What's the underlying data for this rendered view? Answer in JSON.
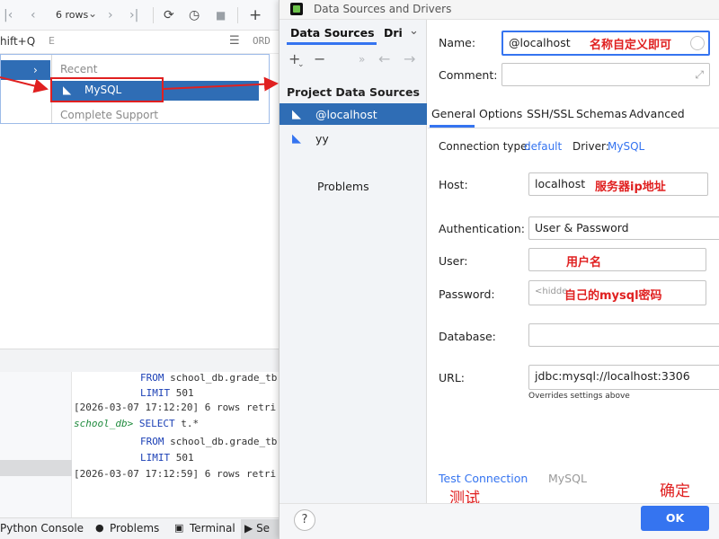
{
  "ide": {
    "toolbar": {
      "first_icon": "|‹",
      "prev_icon": "‹",
      "rows": "6 rows",
      "rows_chevron": "⌄",
      "next_icon": "›",
      "last_icon": "›|",
      "refresh_icon": "⟳",
      "history_icon": "◷",
      "stop_icon": "■",
      "add_icon": "+"
    },
    "row2": {
      "shortcut": "hift+Q",
      "e_label": "E",
      "ord_icon": "☰",
      "ord_label": "ORD"
    },
    "popup": {
      "arrow": "›",
      "recent": "Recent",
      "mysql": "MySQL",
      "complete_support": "Complete Support"
    },
    "console": {
      "lines": [
        {
          "prefix": "",
          "kw": "FROM",
          "rest": " school_db.grade_tb"
        },
        {
          "prefix": "",
          "kw": "LIMIT",
          "rest": " 501"
        },
        {
          "prefix": "[2026-03-07 17:12:20] 6 rows retri",
          "kw": "",
          "rest": ""
        },
        {
          "prompt": "school_db>",
          "kw": " SELECT",
          "rest": " t.*"
        },
        {
          "prefix": "",
          "kw": "FROM",
          "rest": " school_db.grade_tb"
        },
        {
          "prefix": "",
          "kw": "LIMIT",
          "rest": " 501"
        },
        {
          "prefix": "[2026-03-07 17:12:59] 6 rows retri",
          "kw": "",
          "rest": ""
        }
      ]
    },
    "bottom_tabs": {
      "python_console": "Python Console",
      "problems": "Problems",
      "terminal": "Terminal",
      "services": "Se"
    }
  },
  "dialog": {
    "title": "Data Sources and Drivers",
    "tabs": {
      "data_sources": "Data Sources",
      "drivers": "Dri",
      "chevron": "⌄"
    },
    "tools": {
      "add": "+",
      "add_chevron": "⌄",
      "remove": "−",
      "more": "»",
      "back": "←",
      "forward": "→"
    },
    "project_data_sources": "Project Data Sources",
    "sources": [
      {
        "label": "@localhost",
        "icon": "dolphin-icon"
      },
      {
        "label": "yy",
        "icon": "dolphin-icon"
      }
    ],
    "problems": "Problems",
    "name_label": "Name:",
    "name_value": "@localhost",
    "comment_label": "Comment:",
    "comment_value": "",
    "expand_icon": "⤢",
    "config_tabs": [
      "General",
      "Options",
      "SSH/SSL",
      "Schemas",
      "Advanced"
    ],
    "connection_type_label": "Connection type:",
    "connection_type_value": "default",
    "driver_label": "Driver:",
    "driver_value": "MySQL",
    "host_label": "Host:",
    "host_value": "localhost",
    "authentication_label": "Authentication:",
    "authentication_value": "User & Password",
    "user_label": "User:",
    "user_value": "",
    "password_label": "Password:",
    "password_placeholder": "<hidde",
    "database_label": "Database:",
    "database_value": "",
    "url_label": "URL:",
    "url_value": "jdbc:mysql://localhost:3306",
    "url_hint": "Overrides settings above",
    "test_connection": "Test Connection",
    "test_driver": "MySQL",
    "help": "?",
    "ok": "OK"
  },
  "annotations": {
    "name_note": "名称自定义即可",
    "host_note": "服务器ip地址",
    "user_note": "用户名",
    "password_note": "自己的mysql密码",
    "test_note": "测试",
    "ok_note": "确定"
  },
  "colors": {
    "accent": "#3574f0",
    "selection": "#2f6db5",
    "annotation_red": "#e02020"
  }
}
